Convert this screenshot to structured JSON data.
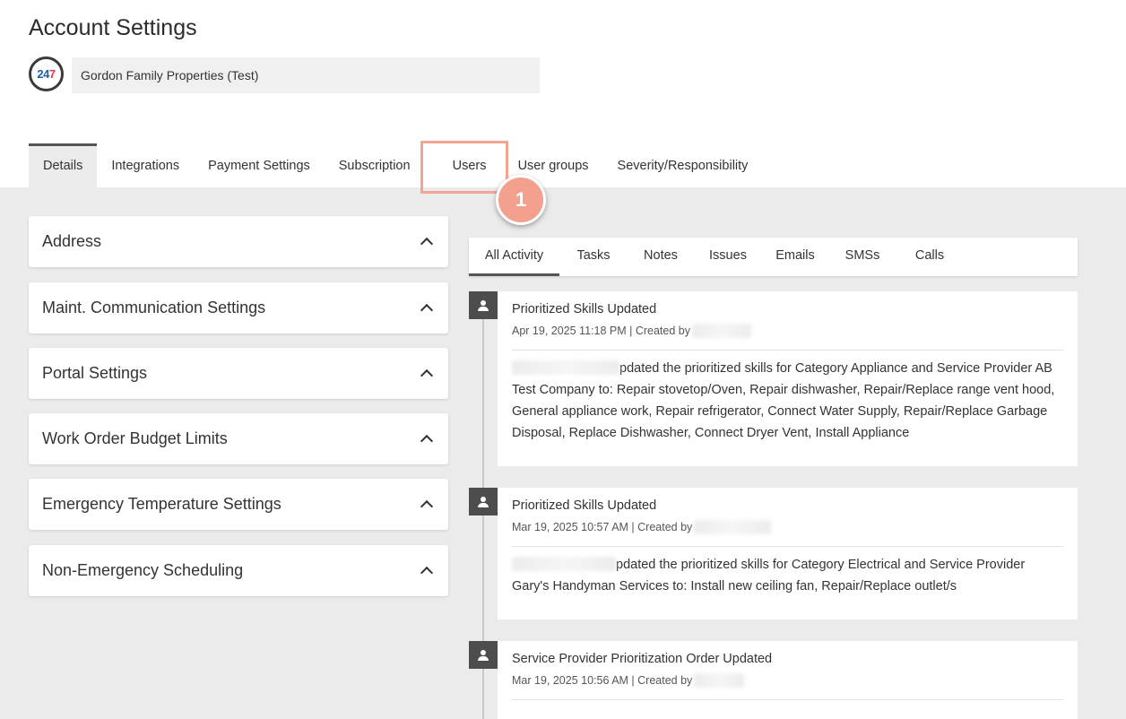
{
  "page": {
    "title": "Account Settings"
  },
  "account": {
    "logo_text_a": "24",
    "logo_text_b": "7",
    "company_name": "Gordon Family Properties (Test)"
  },
  "tabs": [
    {
      "label": "Details",
      "active": true
    },
    {
      "label": "Integrations"
    },
    {
      "label": "Payment Settings"
    },
    {
      "label": "Subscription"
    },
    {
      "label": "Users"
    },
    {
      "label": "User groups"
    },
    {
      "label": "Severity/Responsibility"
    }
  ],
  "annotation": {
    "step": "1",
    "color": "#f3a08e"
  },
  "sections": [
    {
      "label": "Address"
    },
    {
      "label": "Maint. Communication Settings"
    },
    {
      "label": "Portal Settings"
    },
    {
      "label": "Work Order Budget Limits"
    },
    {
      "label": "Emergency Temperature Settings"
    },
    {
      "label": "Non-Emergency Scheduling"
    }
  ],
  "activity_tabs": [
    {
      "label": "All Activity",
      "active": true
    },
    {
      "label": "Tasks"
    },
    {
      "label": "Notes"
    },
    {
      "label": "Issues"
    },
    {
      "label": "Emails"
    },
    {
      "label": "SMSs"
    },
    {
      "label": "Calls"
    }
  ],
  "activities": [
    {
      "icon": "user-icon",
      "title": "Prioritized Skills Updated",
      "meta": "Apr 19, 2025 11:18 PM | Created by",
      "body": "pdated the prioritized skills for Category Appliance and Service Provider AB Test Company to: Repair stovetop/Oven, Repair dishwasher, Repair/Replace range vent hood, General appliance work, Repair refrigerator, Connect Water Supply, Repair/Replace Garbage Disposal, Replace Dishwasher, Connect Dryer Vent, Install Appliance"
    },
    {
      "icon": "user-icon",
      "title": "Prioritized Skills Updated",
      "meta": "Mar 19, 2025 10:57 AM | Created by",
      "body": "pdated the prioritized skills for Category Electrical and Service Provider Gary's Handyman Services to: Install new ceiling fan, Repair/Replace outlet/s"
    },
    {
      "icon": "user-icon",
      "title": "Service Provider Prioritization Order Updated",
      "meta": "Mar 19, 2025 10:56 AM | Created by",
      "body": ""
    }
  ]
}
